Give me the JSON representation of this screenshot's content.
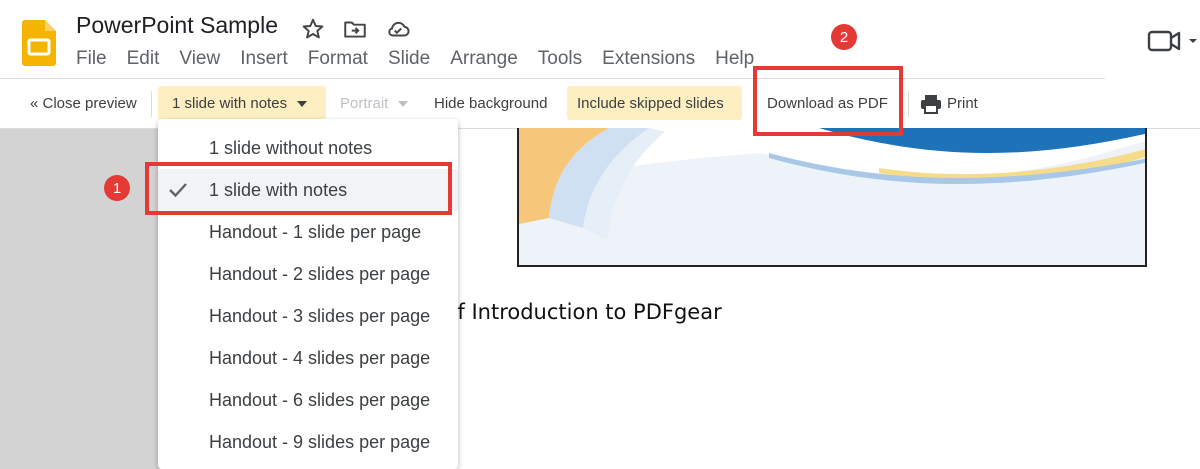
{
  "app": {
    "doc_title": "PowerPoint Sample",
    "menu": [
      "File",
      "Edit",
      "View",
      "Insert",
      "Format",
      "Slide",
      "Arrange",
      "Tools",
      "Extensions",
      "Help"
    ]
  },
  "toolbar": {
    "close_preview": "« Close preview",
    "layout_selected": "1 slide with notes",
    "orientation": "Portrait",
    "hide_background": "Hide background",
    "include_skipped": "Include skipped slides",
    "download_pdf": "Download as PDF",
    "print": "Print"
  },
  "dropdown": {
    "options": [
      "1 slide without notes",
      "1 slide with notes",
      "Handout - 1 slide per page",
      "Handout - 2 slides per page",
      "Handout - 3 slides per page",
      "Handout - 4 slides per page",
      "Handout - 6 slides per page",
      "Handout - 9 slides per page"
    ],
    "selected_index": 1
  },
  "preview": {
    "notes_text": "rief Introduction to PDFgear"
  },
  "annotations": {
    "badge_1": "1",
    "badge_2": "2"
  },
  "colors": {
    "annotation_red": "#e53935",
    "highlight_yellow": "#feefc3",
    "slides_logo": "#f4b400"
  }
}
